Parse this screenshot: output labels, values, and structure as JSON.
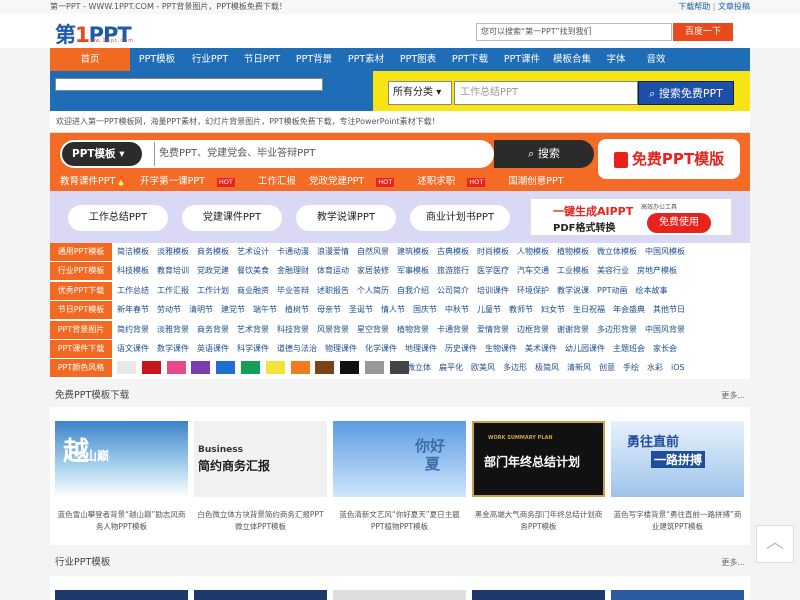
{
  "topbar": {
    "left": "第一PPT - WWW.1PPT.COM - PPT背景图片，PPT模板免费下载！",
    "help": "下载帮助",
    "sep": "|",
    "submit": "文章投稿"
  },
  "logo": {
    "main_a": "第",
    "main_b": "1",
    "main_c": "PPT",
    "sub": "www.1ppt.com"
  },
  "header_search": {
    "placeholder": "您可以搜索“第一PPT”找到我们",
    "button": "百度一下"
  },
  "nav": [
    "首页",
    "PPT模板",
    "行业PPT",
    "节日PPT",
    "PPT背景",
    "PPT素材",
    "PPT图表",
    "PPT下载",
    "PPT课件",
    "模板合集",
    "字体",
    "音效"
  ],
  "search": {
    "button": "搜索",
    "category": "所有分类",
    "category_arrow": "▾",
    "placeholder": "工作总结PPT",
    "go": "搜索免费PPT"
  },
  "welcome": "欢迎进入第一PPT模板网，海量PPT素材，幻灯片背景图片，PPT模板免费下载，专注PowerPoint素材下载！",
  "banner": {
    "select": "PPT模板 ▾",
    "placeholder": "免费PPT、党建党会、毕业答辩PPT",
    "go": "搜索",
    "free": "免费PPT模版",
    "tags": [
      {
        "t": "教育课件PPT🔥",
        "hot": ""
      },
      {
        "t": "开学第一课PPT",
        "hot": "HOT"
      },
      {
        "t": "工作汇报",
        "hot": ""
      },
      {
        "t": "党政党建PPT",
        "hot": "HOT"
      },
      {
        "t": "述职求职",
        "hot": "HOT"
      },
      {
        "t": "国潮创意PPT",
        "hot": ""
      }
    ]
  },
  "cats": [
    "工作总结PPT",
    "党建课件PPT",
    "教学说课PPT",
    "商业计划书PPT"
  ],
  "ai": {
    "line1": "一键生成AIPPT",
    "line2": "PDF格式转换",
    "badge": "高效办公工具",
    "use": "免费使用"
  },
  "tag_rows": [
    {
      "label": "通用PPT模板",
      "links": [
        "简洁模板",
        "淡雅模板",
        "商务模板",
        "艺术设计",
        "卡通动漫",
        "浪漫爱情",
        "自然风景",
        "建筑模板",
        "古典模板",
        "时尚模板",
        "人物模板",
        "植物模板",
        "微立体模板",
        "中国风模板"
      ]
    },
    {
      "label": "行业PPT模板",
      "links": [
        "科技模板",
        "教育培训",
        "党政党建",
        "餐饮美食",
        "金融理财",
        "体育运动",
        "家居装修",
        "军事模板",
        "旅游旅行",
        "医学医疗",
        "汽车交通",
        "工业模板",
        "美容行业",
        "房地产模板"
      ]
    },
    {
      "label": "优秀PPT下载",
      "links": [
        "工作总结",
        "工作汇报",
        "工作计划",
        "商业融资",
        "毕业答辩",
        "述职报告",
        "个人简历",
        "自我介绍",
        "公司简介",
        "培训课件",
        "环境保护",
        "教学说课",
        "PPT动画",
        "绘本故事"
      ]
    },
    {
      "label": "节日PPT模板",
      "links": [
        "新年春节",
        "劳动节",
        "清明节",
        "建党节",
        "端午节",
        "植树节",
        "母亲节",
        "圣诞节",
        "情人节",
        "国庆节",
        "中秋节",
        "儿童节",
        "教师节",
        "妇女节",
        "生日祝福",
        "年会盛典",
        "其他节日"
      ]
    },
    {
      "label": "PPT背景图片",
      "links": [
        "简约背景",
        "淡雅背景",
        "商务背景",
        "艺术背景",
        "科技背景",
        "风景背景",
        "星空背景",
        "植物背景",
        "卡通背景",
        "爱情背景",
        "边框背景",
        "谢谢背景",
        "多边形背景",
        "中国风背景"
      ]
    },
    {
      "label": "PPT课件下载",
      "links": [
        "语文课件",
        "数学课件",
        "英语课件",
        "科学课件",
        "道德与法治",
        "物理课件",
        "化学课件",
        "地理课件",
        "历史课件",
        "生物课件",
        "美术课件",
        "幼儿园课件",
        "主题班会",
        "家长会"
      ]
    },
    {
      "label": "PPT颜色风格",
      "links": [
        "微立体",
        "扁平化",
        "欧美风",
        "多边形",
        "极简风",
        "清新风",
        "创意",
        "手绘",
        "水彩",
        "iOS"
      ]
    }
  ],
  "swatches": [
    "#e8e8e8",
    "#c8161d",
    "#e84a8a",
    "#7a3cb0",
    "#1f6fd0",
    "#15a05a",
    "#f3e23a",
    "#f37b1d",
    "#7a4317",
    "#111111",
    "#999999",
    "#444444"
  ],
  "section1": {
    "title": "免费PPT模板下载",
    "more": "更多..."
  },
  "cards": [
    {
      "cap": "蓝色雪山攀登者背景“越山巅”励志风商务人物PPT模板",
      "big": "越",
      "small": "山巅"
    },
    {
      "cap": "白色微立体方块背景简约商务汇报PPT微立体PPT模板",
      "big": "Business",
      "small": "简约商务汇报"
    },
    {
      "cap": "蓝色清新文艺风“你好夏天”夏日主题PPT植物PPT模板",
      "big": "你好",
      "small": "夏"
    },
    {
      "cap": "黑金高端大气商务部门年终总结计划商务PPT模板",
      "big": "部门年终总结计划",
      "small": "WORK SUMMARY PLAN"
    },
    {
      "cap": "蓝色写字楼背景“勇往直前一路拼搏”商业建筑PPT模板",
      "big": "勇往直前",
      "small": "一路拼搏"
    }
  ],
  "section2": {
    "title": "行业PPT模板",
    "more": "更多..."
  },
  "totop": "︿"
}
